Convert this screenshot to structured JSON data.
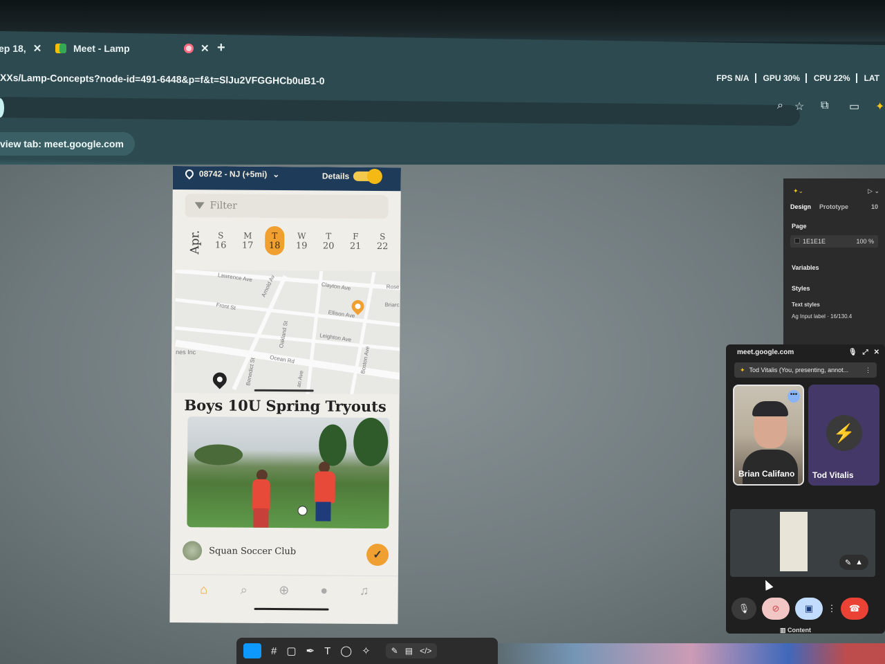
{
  "browser": {
    "tabs": [
      {
        "label": "ep 18,",
        "close": "✕"
      },
      {
        "label": "Meet - Lamp",
        "close": "✕"
      }
    ],
    "new_tab": "+",
    "url": "XXs/Lamp-Concepts?node-id=491-6448&p=f&t=SlJu2VFGGHCb0uB1-0",
    "perf": {
      "fps": "FPS N/A",
      "gpu": "GPU 30%",
      "cpu": "CPU 22%",
      "lat": "LAT"
    },
    "sharing_notice": "view tab: meet.google.com"
  },
  "app": {
    "location": "08742 - NJ (+5mi)",
    "details_label": "Details",
    "filter_placeholder": "Filter",
    "month": "Apr.",
    "days": [
      {
        "dow": "S",
        "num": "16"
      },
      {
        "dow": "M",
        "num": "17"
      },
      {
        "dow": "T",
        "num": "18",
        "selected": true
      },
      {
        "dow": "W",
        "num": "19"
      },
      {
        "dow": "T",
        "num": "20"
      },
      {
        "dow": "F",
        "num": "21"
      },
      {
        "dow": "S",
        "num": "22"
      }
    ],
    "map_streets": [
      "Lawrence Ave",
      "Clayton Ave",
      "Arnold Av",
      "Front St",
      "Ellison Ave",
      "Leighton Ave",
      "Ocean Rd",
      "Oakland St",
      "Benedict St",
      "Boston Ave",
      "Rose",
      "Briarc",
      "nes Inc",
      "an Ave"
    ],
    "event_title": "Boys 10U Spring Tryouts",
    "club_name": "Squan Soccer Club",
    "accent": "#f0a030",
    "header_color": "#1f3b5a"
  },
  "figma_panel": {
    "tabs": [
      "Design",
      "Prototype"
    ],
    "tab_extra": "10",
    "page_label": "Page",
    "page_color": "1E1E1E",
    "page_opacity": "100",
    "page_opacity_unit": "%",
    "variables": "Variables",
    "styles": "Styles",
    "text_styles": "Text styles",
    "text_style_item": "Input label · 16/130.4"
  },
  "meet": {
    "host": "meet.google.com",
    "presenting": "Tod Vitalis (You, presenting, annot...",
    "participants": [
      "Brian Califano",
      "Tod Vitalis"
    ],
    "content_label": "Content"
  }
}
